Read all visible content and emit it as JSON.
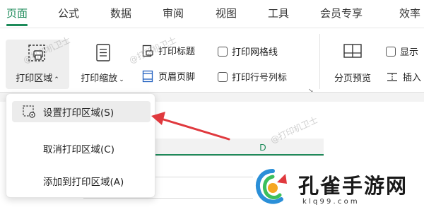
{
  "tabs": [
    "页面",
    "公式",
    "数据",
    "审阅",
    "视图",
    "工具",
    "会员专享",
    "效率"
  ],
  "active_tab": "页面",
  "ribbon": {
    "print_area": {
      "label": "打印区域",
      "icon": "print-area-icon"
    },
    "print_scale": {
      "label": "打印缩放",
      "icon": "print-scale-icon"
    },
    "print_title": {
      "label": "打印标题",
      "icon": "print-title-icon"
    },
    "header_footer": {
      "label": "页眉页脚",
      "icon": "header-footer-icon"
    },
    "print_gridlines": {
      "label": "打印网格线",
      "checked": false
    },
    "print_row_col_headers": {
      "label": "打印行号列标",
      "checked": false
    },
    "page_break_preview": {
      "label": "分页预览",
      "icon": "page-break-icon"
    },
    "show": {
      "label": "显示",
      "checked": false
    },
    "insert": {
      "label": "插入",
      "icon": "insert-icon"
    }
  },
  "dropdown": {
    "items": [
      {
        "label": "设置打印区域(S)",
        "icon": "set-print-area-icon",
        "highlighted": true
      },
      {
        "label": "取消打印区域(C)"
      },
      {
        "label": "添加到打印区域(A)"
      }
    ]
  },
  "sheet": {
    "column_label": "D"
  },
  "watermark": {
    "text": "@打印机卫士"
  },
  "logo": {
    "title": "孔雀手游网",
    "url": "k l q 9 9 . c o m"
  },
  "colors": {
    "accent": "#1d8b5a",
    "arrow": "#e0393e"
  }
}
